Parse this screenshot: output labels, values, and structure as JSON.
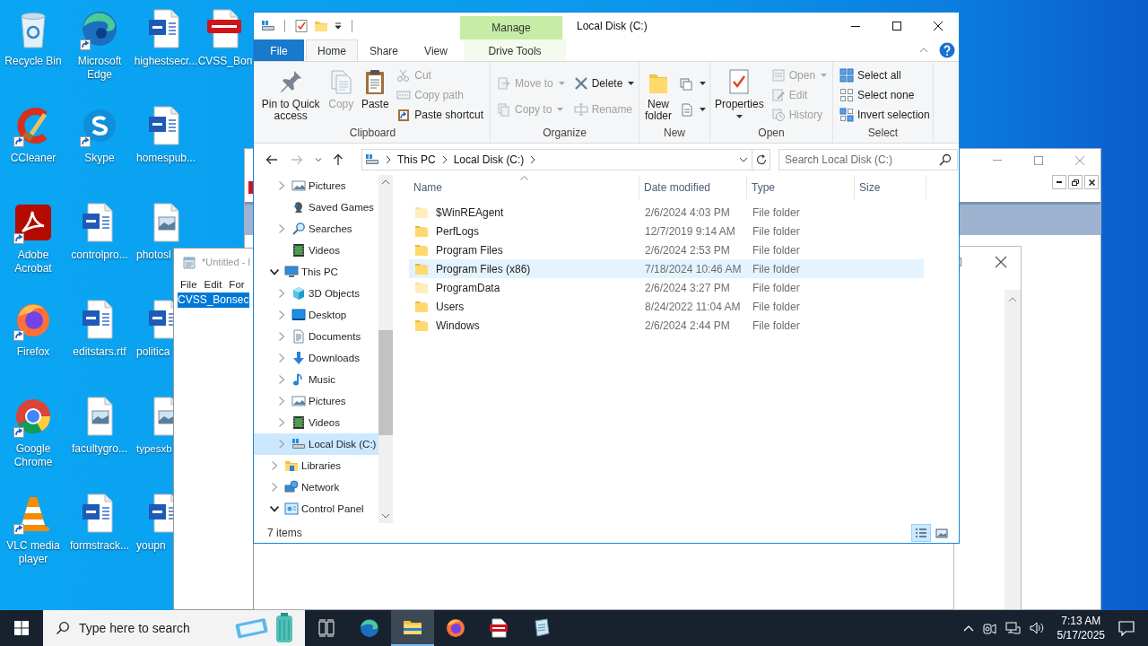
{
  "desktop": {
    "icons": [
      {
        "label": "Recycle Bin",
        "kind": "bin",
        "shortcut": false
      },
      {
        "label": "CCleaner",
        "kind": "cleaner",
        "shortcut": true
      },
      {
        "label": "Adobe Acrobat",
        "kind": "acrobat",
        "shortcut": true
      },
      {
        "label": "Firefox",
        "kind": "firefox",
        "shortcut": true
      },
      {
        "label": "Google Chrome",
        "kind": "chrome",
        "shortcut": true
      },
      {
        "label": "VLC media player",
        "kind": "vlc",
        "shortcut": true
      },
      {
        "label": "Microsoft Edge",
        "kind": "edge",
        "shortcut": true
      },
      {
        "label": "Skype",
        "kind": "skype",
        "shortcut": true
      },
      {
        "label": "controlpro...",
        "kind": "word",
        "shortcut": false
      },
      {
        "label": "editstars.rtf",
        "kind": "word",
        "shortcut": false
      },
      {
        "label": "facultygro...",
        "kind": "image",
        "shortcut": false
      },
      {
        "label": "formstrack...",
        "kind": "word",
        "shortcut": false
      },
      {
        "label": "highestsecr...",
        "kind": "word",
        "shortcut": false
      },
      {
        "label": "homespub...",
        "kind": "word",
        "shortcut": false
      },
      {
        "label": "photosl",
        "kind": "image",
        "shortcut": false
      },
      {
        "label": "politica",
        "kind": "word",
        "shortcut": false
      },
      {
        "label": "typesxb",
        "kind": "image",
        "shortcut": false
      },
      {
        "label": "youpn",
        "kind": "word",
        "shortcut": false
      },
      {
        "label": "CVSS_Bon",
        "kind": "pdf",
        "shortcut": false
      }
    ]
  },
  "notepad": {
    "title": "*Untitled - I",
    "menu": [
      "File",
      "Edit",
      "For"
    ],
    "selected_text": "CVSS_Bonsec"
  },
  "explorer": {
    "title": "Local Disk (C:)",
    "context_group": "Manage",
    "tabs": [
      {
        "label": "File",
        "kind": "file",
        "selected": false
      },
      {
        "label": "Home",
        "kind": "tab",
        "selected": true
      },
      {
        "label": "Share",
        "kind": "tab",
        "selected": false
      },
      {
        "label": "View",
        "kind": "tab",
        "selected": false
      },
      {
        "label": "Drive Tools",
        "kind": "context",
        "selected": false
      }
    ],
    "ribbon": [
      {
        "label": "Clipboard",
        "columns": [
          [
            {
              "label": "Pin to Quick access",
              "kind": "pin",
              "disabled": false,
              "dropdown": false
            }
          ],
          [
            {
              "label": "Copy",
              "kind": "copy",
              "disabled": true,
              "dropdown": false
            }
          ],
          [
            {
              "label": "Paste",
              "kind": "paste",
              "disabled": false,
              "dropdown": false
            }
          ],
          [
            {
              "label": "Cut",
              "kind": "cut",
              "disabled": true,
              "dropdown": false
            },
            {
              "label": "Copy path",
              "kind": "copypath",
              "disabled": true,
              "dropdown": false
            },
            {
              "label": "Paste shortcut",
              "kind": "pasteshortcut",
              "disabled": false,
              "dropdown": false
            }
          ]
        ]
      },
      {
        "label": "Organize",
        "columns": [
          [
            {
              "label": "Move to",
              "kind": "moveto",
              "disabled": true,
              "dropdown": true
            },
            {
              "label": "Copy to",
              "kind": "copyto",
              "disabled": true,
              "dropdown": true
            }
          ],
          [
            {
              "label": "Delete",
              "kind": "delete",
              "disabled": false,
              "dropdown": true
            },
            {
              "label": "Rename",
              "kind": "rename",
              "disabled": true,
              "dropdown": false
            }
          ]
        ]
      },
      {
        "label": "New",
        "columns": [
          [
            {
              "label": "New folder",
              "kind": "newfolder",
              "disabled": false,
              "dropdown": false
            }
          ],
          [
            {
              "kind": "newitem",
              "disabled": false,
              "dropdown": true
            },
            {
              "kind": "easyaccess",
              "disabled": false,
              "dropdown": true
            }
          ]
        ]
      },
      {
        "label": "Open",
        "columns": [
          [
            {
              "label": "Properties",
              "kind": "properties",
              "disabled": false,
              "dropdown": true
            }
          ],
          [
            {
              "label": "Open",
              "kind": "open",
              "disabled": true,
              "dropdown": true
            },
            {
              "label": "Edit",
              "kind": "edit",
              "disabled": true,
              "dropdown": false
            },
            {
              "label": "History",
              "kind": "history",
              "disabled": true,
              "dropdown": false
            }
          ]
        ]
      },
      {
        "label": "Select",
        "columns": [
          [
            {
              "label": "Select all",
              "kind": "selectall",
              "disabled": false,
              "dropdown": false
            },
            {
              "label": "Select none",
              "kind": "selectnone",
              "disabled": false,
              "dropdown": false
            },
            {
              "label": "Invert selection",
              "kind": "invert",
              "disabled": false,
              "dropdown": false
            }
          ]
        ]
      }
    ],
    "address": {
      "path": [
        "This PC",
        "Local Disk (C:)"
      ]
    },
    "search": {
      "placeholder": "Search Local Disk (C:)"
    },
    "nav": [
      {
        "children": [
          {
            "label": "Pictures",
            "kind": "pictures",
            "expandable": true,
            "expanded": false,
            "selected": false
          },
          {
            "label": "Saved Games",
            "kind": "games",
            "expandable": false,
            "selected": false
          },
          {
            "label": "Searches",
            "kind": "searches",
            "expandable": true,
            "expanded": false,
            "selected": false
          },
          {
            "label": "Videos",
            "kind": "videos",
            "expandable": false,
            "selected": false
          }
        ]
      },
      {
        "label": "This PC",
        "kind": "computer",
        "expandable": true,
        "expanded": true,
        "selected": false,
        "children": [
          {
            "label": "3D Objects",
            "kind": "objects",
            "expandable": true,
            "expanded": false,
            "selected": false
          },
          {
            "label": "Desktop",
            "kind": "desktop",
            "expandable": true,
            "expanded": false,
            "selected": false
          },
          {
            "label": "Documents",
            "kind": "documents",
            "expandable": true,
            "expanded": false,
            "selected": false
          },
          {
            "label": "Downloads",
            "kind": "downloads",
            "expandable": true,
            "expanded": false,
            "selected": false
          },
          {
            "label": "Music",
            "kind": "music",
            "expandable": true,
            "expanded": false,
            "selected": false
          },
          {
            "label": "Pictures",
            "kind": "pictures",
            "expandable": true,
            "expanded": false,
            "selected": false
          },
          {
            "label": "Videos",
            "kind": "videos",
            "expandable": true,
            "expanded": false,
            "selected": false
          },
          {
            "label": "Local Disk (C:)",
            "kind": "drive",
            "expandable": true,
            "expanded": false,
            "selected": true
          }
        ]
      },
      {
        "label": "Libraries",
        "kind": "libraries",
        "expandable": true,
        "expanded": false,
        "selected": false
      },
      {
        "label": "Network",
        "kind": "network",
        "expandable": true,
        "expanded": false,
        "selected": false
      },
      {
        "label": "Control Panel",
        "kind": "panel",
        "expandable": true,
        "expanded": true,
        "selected": false
      }
    ],
    "columns": [
      {
        "label": "Name",
        "sorted": true
      },
      {
        "label": "Date modified",
        "sorted": false
      },
      {
        "label": "Type",
        "sorted": false
      },
      {
        "label": "Size",
        "sorted": false
      }
    ],
    "rows": [
      {
        "name": "$WinREAgent",
        "date": "2/6/2024 4:03 PM",
        "type": "File folder",
        "hidden": true,
        "selected": false
      },
      {
        "name": "PerfLogs",
        "date": "12/7/2019 9:14 AM",
        "type": "File folder",
        "hidden": false,
        "selected": false
      },
      {
        "name": "Program Files",
        "date": "2/6/2024 2:53 PM",
        "type": "File folder",
        "hidden": false,
        "selected": false
      },
      {
        "name": "Program Files (x86)",
        "date": "7/18/2024 10:46 AM",
        "type": "File folder",
        "hidden": false,
        "selected": true
      },
      {
        "name": "ProgramData",
        "date": "2/6/2024 3:27 PM",
        "type": "File folder",
        "hidden": true,
        "selected": false
      },
      {
        "name": "Users",
        "date": "8/24/2022 11:04 AM",
        "type": "File folder",
        "hidden": false,
        "selected": false
      },
      {
        "name": "Windows",
        "date": "2/6/2024 2:44 PM",
        "type": "File folder",
        "hidden": false,
        "selected": false
      }
    ],
    "status": "7 items",
    "views": [
      {
        "kind": "details",
        "selected": true
      },
      {
        "kind": "tiles",
        "selected": false
      }
    ]
  },
  "taskbar": {
    "search": {
      "placeholder": "Type here to search"
    },
    "apps": [
      {
        "kind": "edge",
        "active": false
      },
      {
        "kind": "explorer",
        "active": true
      },
      {
        "kind": "firefox",
        "active": false
      },
      {
        "kind": "pdf",
        "active": false
      },
      {
        "kind": "notepad",
        "active": false
      }
    ],
    "clock": {
      "time": "7:13 AM",
      "date": "5/17/2025"
    }
  }
}
